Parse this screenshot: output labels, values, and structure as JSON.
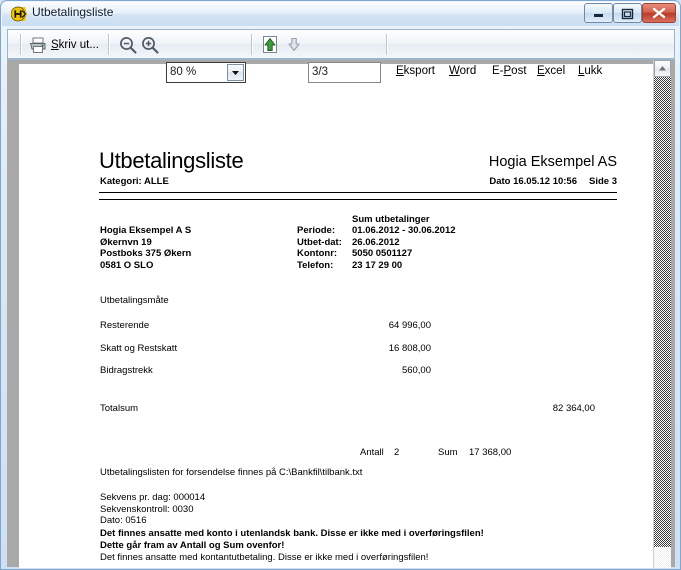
{
  "window": {
    "title": "Utbetalingsliste",
    "app_icon": "hogia-h-icon",
    "minimize_label": "Minimize",
    "maximize_label": "Maximize",
    "close_label": "Close"
  },
  "toolbar": {
    "print_label": "Skriv ut...",
    "print_icon": "printer-icon",
    "zoom_out_icon": "zoom-out-icon",
    "zoom_in_icon": "zoom-in-icon",
    "zoom_value": "80 %",
    "zoom_dropdown_icon": "chevron-down-icon",
    "prev_page_icon": "arrow-up-green-icon",
    "next_page_icon": "arrow-down-gray-icon",
    "page_value": "3/3",
    "menu": {
      "eksport": "Eksport",
      "word": "Word",
      "epost": "E-Post",
      "excel": "Excel",
      "lukk": "Lukk"
    }
  },
  "scrollbar": {
    "up_icon": "scroll-up-arrow-icon"
  },
  "document": {
    "title": "Utbetalingsliste",
    "company": "Hogia Eksempel AS",
    "kategori": "Kategori: ALLE",
    "dato": "Dato  16.05.12 10:56",
    "side": "Side 3",
    "address": [
      "Hogia Eksempel A S",
      "Økernvn 19",
      "Postboks 375 Økern",
      "0581  O SLO"
    ],
    "sum_heading": "Sum utbetalinger",
    "info_labels": [
      "Periode:",
      "Utbet-dat:",
      "Kontonr:",
      "Telefon:"
    ],
    "info_values": [
      "01.06.2012 - 30.06.2012",
      "26.06.2012",
      "5050 0501127",
      "23  17  29 00"
    ],
    "utbetalingsmaate": "Utbetalingsmåte",
    "rows": [
      {
        "label": "Resterende",
        "amount": "64 996,00"
      },
      {
        "label": "Skatt og Restskatt",
        "amount": "16 808,00"
      },
      {
        "label": "Bidragstrekk",
        "amount": "560,00"
      }
    ],
    "totalsum_label": "Totalsum",
    "totalsum_amount": "82 364,00",
    "antall_label": "Antall",
    "antall_value": "2",
    "sum_label": "Sum",
    "sum_value": "17 368,00",
    "note_file": "Utbetalingslisten for forsendelse finnes på C:\\Bankfil\\tilbank.txt",
    "sequence": [
      "Sekvens pr. dag: 000014",
      "Sekvenskontroll: 0030",
      "Dato: 0516"
    ],
    "warnings": [
      "Det finnes ansatte med konto i utenlandsk bank. Disse er ikke med i overføringsfilen!",
      "Dette går fram av Antall og Sum ovenfor!",
      "Det  finnes ansatte med kontantutbetaling. Disse er ikke med i overføringsfilen!"
    ]
  },
  "colors": {
    "title_bar_text": "#0a1b33",
    "close_button": "#b83a28",
    "arrow_enabled": "#2e7d32",
    "arrow_disabled": "#9aa4ae",
    "page_background": "#ffffff",
    "doc_frame": "#a9a9a9"
  }
}
